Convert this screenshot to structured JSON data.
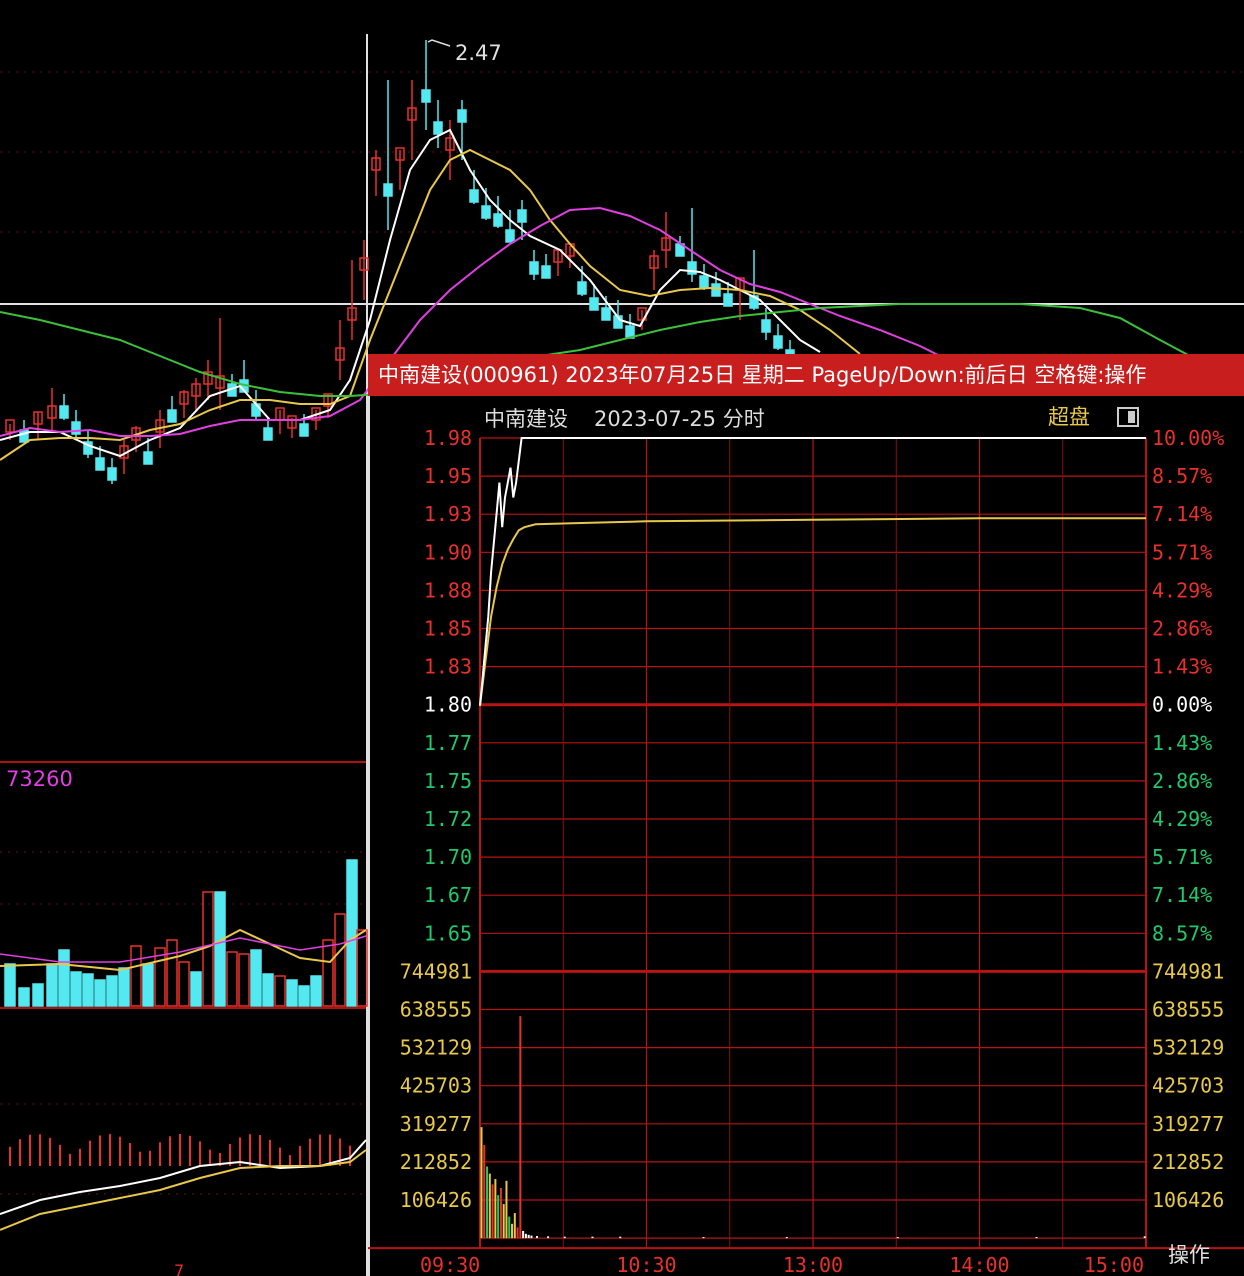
{
  "background_chart": {
    "peak_label": "2.47",
    "volume_label": "73260",
    "bottom_tick": "7"
  },
  "popup": {
    "title": "中南建设(000961) 2023年07月25日 星期二 PageUp/Down:前后日 空格键:操作",
    "subheader_name": "中南建设",
    "subheader_date": "2023-07-25 分时",
    "super_label": "超盘",
    "ops_label": "操作"
  },
  "colors": {
    "up": "#e8312a",
    "down": "#22c96a",
    "neutral": "#ffffff",
    "grid": "#b01010",
    "avg_line": "#e8c84a",
    "price_line": "#ffffff",
    "candle_down": "#54e8f0",
    "ma_magenta": "#e040e0",
    "ma_green": "#3cc03c"
  },
  "chart_data": {
    "type": "line",
    "title": "中南建设 2023-07-25 分时",
    "price_ticks": [
      "1.98",
      "1.95",
      "1.93",
      "1.90",
      "1.88",
      "1.85",
      "1.83",
      "1.80",
      "1.77",
      "1.75",
      "1.72",
      "1.70",
      "1.67",
      "1.65"
    ],
    "pct_ticks": [
      "10.00%",
      "8.57%",
      "7.14%",
      "5.71%",
      "4.29%",
      "2.86%",
      "1.43%",
      "0.00%",
      "1.43%",
      "2.86%",
      "4.29%",
      "5.71%",
      "7.14%",
      "8.57%"
    ],
    "volume_ticks": [
      "744981",
      "638555",
      "532129",
      "425703",
      "319277",
      "212852",
      "106426"
    ],
    "time_ticks": [
      "09:30",
      "10:30",
      "13:00",
      "14:00",
      "15:00"
    ],
    "prev_close": 1.8,
    "ylim": [
      1.638,
      1.98
    ],
    "volume_max": 744981,
    "total_minutes": 240,
    "price_series": {
      "name": "price",
      "x": [
        0,
        1,
        2,
        3,
        4,
        5,
        6,
        7,
        8,
        9,
        10,
        11,
        12,
        13,
        15,
        20,
        240
      ],
      "y": [
        1.8,
        1.82,
        1.84,
        1.86,
        1.89,
        1.91,
        1.93,
        1.95,
        1.92,
        1.94,
        1.95,
        1.96,
        1.94,
        1.95,
        1.98,
        1.98,
        1.98
      ]
    },
    "avg_series": {
      "name": "avg",
      "x": [
        0,
        2,
        4,
        6,
        8,
        10,
        12,
        14,
        16,
        20,
        40,
        60,
        120,
        180,
        240
      ],
      "y": [
        1.8,
        1.83,
        1.86,
        1.88,
        1.895,
        1.905,
        1.912,
        1.918,
        1.92,
        1.922,
        1.923,
        1.924,
        1.925,
        1.926,
        1.926
      ]
    },
    "volume_series": {
      "name": "volume",
      "x": [
        0,
        1,
        2,
        3,
        4,
        5,
        6,
        7,
        8,
        9,
        10,
        11,
        12,
        13,
        14,
        15,
        16,
        17,
        18,
        20,
        24,
        30,
        40,
        50,
        80,
        110,
        150,
        200,
        239
      ],
      "y": [
        310000,
        260000,
        200000,
        180000,
        150000,
        165000,
        120000,
        140000,
        95000,
        160000,
        60000,
        40000,
        70000,
        30000,
        620000,
        20000,
        12000,
        9000,
        7000,
        6000,
        5000,
        4000,
        4000,
        4000,
        3000,
        3000,
        3000,
        3000,
        5000
      ]
    }
  }
}
